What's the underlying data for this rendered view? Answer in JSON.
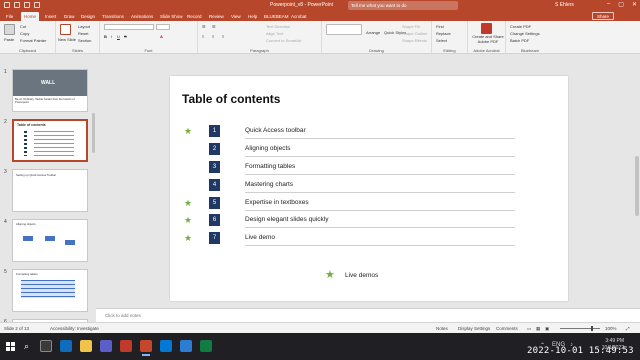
{
  "window": {
    "title": "Powerpoint_v8 - PowerPoint",
    "search_placeholder": "Tell me what you want to do",
    "user": "S Ehlers"
  },
  "tabs": [
    "File",
    "Home",
    "Insert",
    "Draw",
    "Design",
    "Transitions",
    "Animations",
    "Slide Show",
    "Record",
    "Review",
    "View",
    "Help",
    "BLUEBEAM",
    "Acrobat"
  ],
  "active_tab": "Home",
  "share_label": "Share",
  "ribbon": {
    "clipboard": {
      "label": "Clipboard",
      "cut": "Cut",
      "copy": "Copy",
      "format_painter": "Format Painter",
      "paste": "Paste"
    },
    "slides": {
      "label": "Slides",
      "new_slide": "New Slide",
      "layout": "Layout",
      "reset": "Reset",
      "section": "Section"
    },
    "font": {
      "label": "Font"
    },
    "paragraph": {
      "label": "Paragraph",
      "text_direction": "Text Direction",
      "align_text": "Align Text",
      "convert_smartart": "Convert to SmartArt"
    },
    "drawing": {
      "label": "Drawing",
      "arrange": "Arrange",
      "quick_styles": "Quick Styles",
      "shape_fill": "Shape Fill",
      "shape_outline": "Shape Outline",
      "shape_effects": "Shape Effects"
    },
    "editing": {
      "label": "Editing",
      "find": "Find",
      "replace": "Replace",
      "select": "Select"
    },
    "adobe": {
      "label": "Adobe Acrobat",
      "create_share": "Create and Share Adobe PDF"
    },
    "bluebeam": {
      "label": "Bluebeam",
      "create_pdf": "Create PDF",
      "change_settings": "Change Settings",
      "batch_pdf": "Batch PDF"
    }
  },
  "thumbnails": [
    {
      "num": "1",
      "text": "Be an Ordinary. Tackle harder then the basics of Powerpoint",
      "badge": "WALL"
    },
    {
      "num": "2",
      "text": "Table of contents"
    },
    {
      "num": "3",
      "text": "Setting up Quick Access Toolbar"
    },
    {
      "num": "4",
      "text": "Aligning objects"
    },
    {
      "num": "5",
      "text": "Formatting tables"
    },
    {
      "num": "6",
      "text": ""
    }
  ],
  "slide": {
    "title": "Table of contents",
    "items": [
      {
        "num": "1",
        "label": "Quick Access toolbar",
        "star": true
      },
      {
        "num": "2",
        "label": "Aligning objects",
        "star": false
      },
      {
        "num": "3",
        "label": "Formatting tables",
        "star": false
      },
      {
        "num": "4",
        "label": "Mastering charts",
        "star": false
      },
      {
        "num": "5",
        "label": "Expertise in textboxes",
        "star": true
      },
      {
        "num": "6",
        "label": "Design elegant slides quickly",
        "star": true
      },
      {
        "num": "7",
        "label": "Live demo",
        "star": true
      }
    ],
    "legend_label": "Live demos",
    "star_glyph": "★",
    "star_color": "#70b043",
    "num_color": "#1f3864"
  },
  "notes_placeholder": "Click to add notes",
  "status": {
    "slide_pos": "Slide 2 of 13",
    "accessibility": "Accessibility: Investigate",
    "notes": "Notes",
    "display_settings": "Display Settings",
    "comments": "Comments",
    "zoom": "100%"
  },
  "taskbar": {
    "time": "3:49 PM",
    "date": "10/1/2022",
    "language": "ENG"
  },
  "recording_stamp": "2022-10-01  15:49:53",
  "accent": "#b7472a"
}
